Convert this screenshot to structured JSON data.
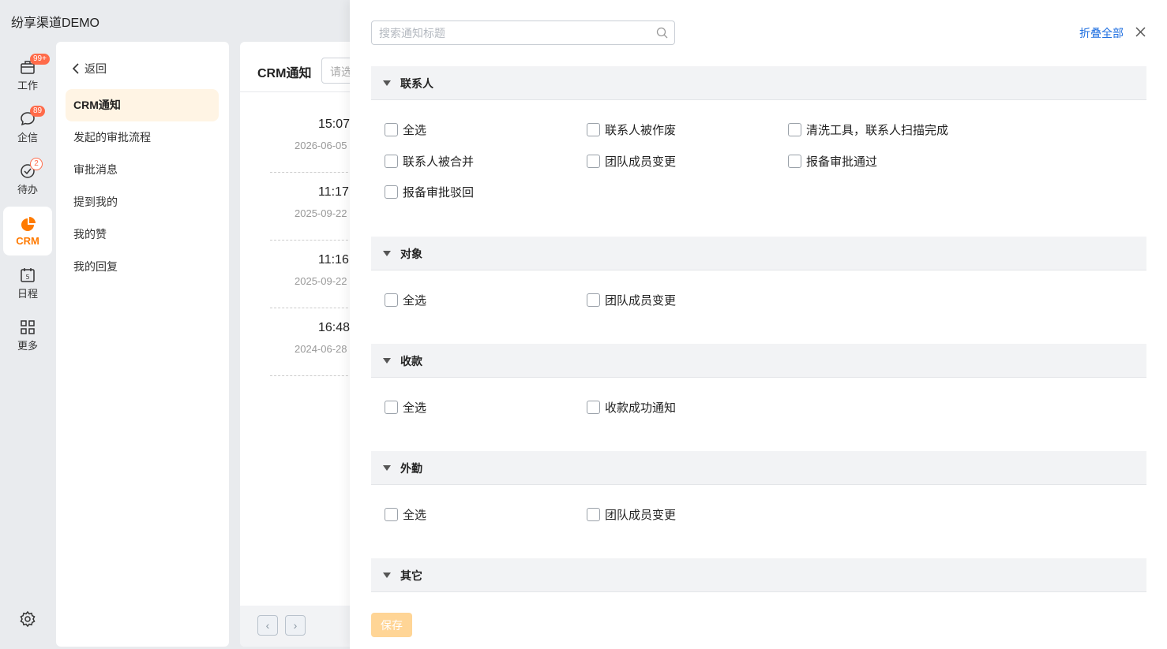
{
  "app": {
    "title": "纷享渠道DEMO"
  },
  "rail": {
    "items": [
      {
        "label": "工作",
        "badge": "99+"
      },
      {
        "label": "企信",
        "badge": "89"
      },
      {
        "label": "待办",
        "badge": "2"
      },
      {
        "label": "CRM",
        "badge": ""
      },
      {
        "label": "日程",
        "badge": ""
      },
      {
        "label": "更多",
        "badge": ""
      }
    ],
    "accent": "#ff7a00"
  },
  "subnav": {
    "back_label": "返回",
    "items": [
      {
        "label": "CRM通知"
      },
      {
        "label": "发起的审批流程"
      },
      {
        "label": "审批消息"
      },
      {
        "label": "提到我的"
      },
      {
        "label": "我的赞"
      },
      {
        "label": "我的回复"
      }
    ]
  },
  "list": {
    "title": "CRM通知",
    "search_placeholder": "请选",
    "entries": [
      {
        "time": "15:07",
        "date": "2026-06-05"
      },
      {
        "time": "11:17",
        "date": "2025-09-22"
      },
      {
        "time": "11:16",
        "date": "2025-09-22"
      },
      {
        "time": "16:48",
        "date": "2024-06-28"
      }
    ]
  },
  "drawer": {
    "search_placeholder": "搜索通知标题",
    "collapse_all": "折叠全部",
    "save_label": "保存",
    "sections": [
      {
        "title": "联系人",
        "options": [
          "全选",
          "联系人被作废",
          "清洗工具，联系人扫描完成",
          "联系人被合并",
          "团队成员变更",
          "报备审批通过",
          "报备审批驳回"
        ]
      },
      {
        "title": "对象",
        "options": [
          "全选",
          "团队成员变更"
        ]
      },
      {
        "title": "收款",
        "options": [
          "全选",
          "收款成功通知"
        ]
      },
      {
        "title": "外勤",
        "options": [
          "全选",
          "团队成员变更"
        ]
      },
      {
        "title": "其它",
        "options": []
      }
    ]
  }
}
